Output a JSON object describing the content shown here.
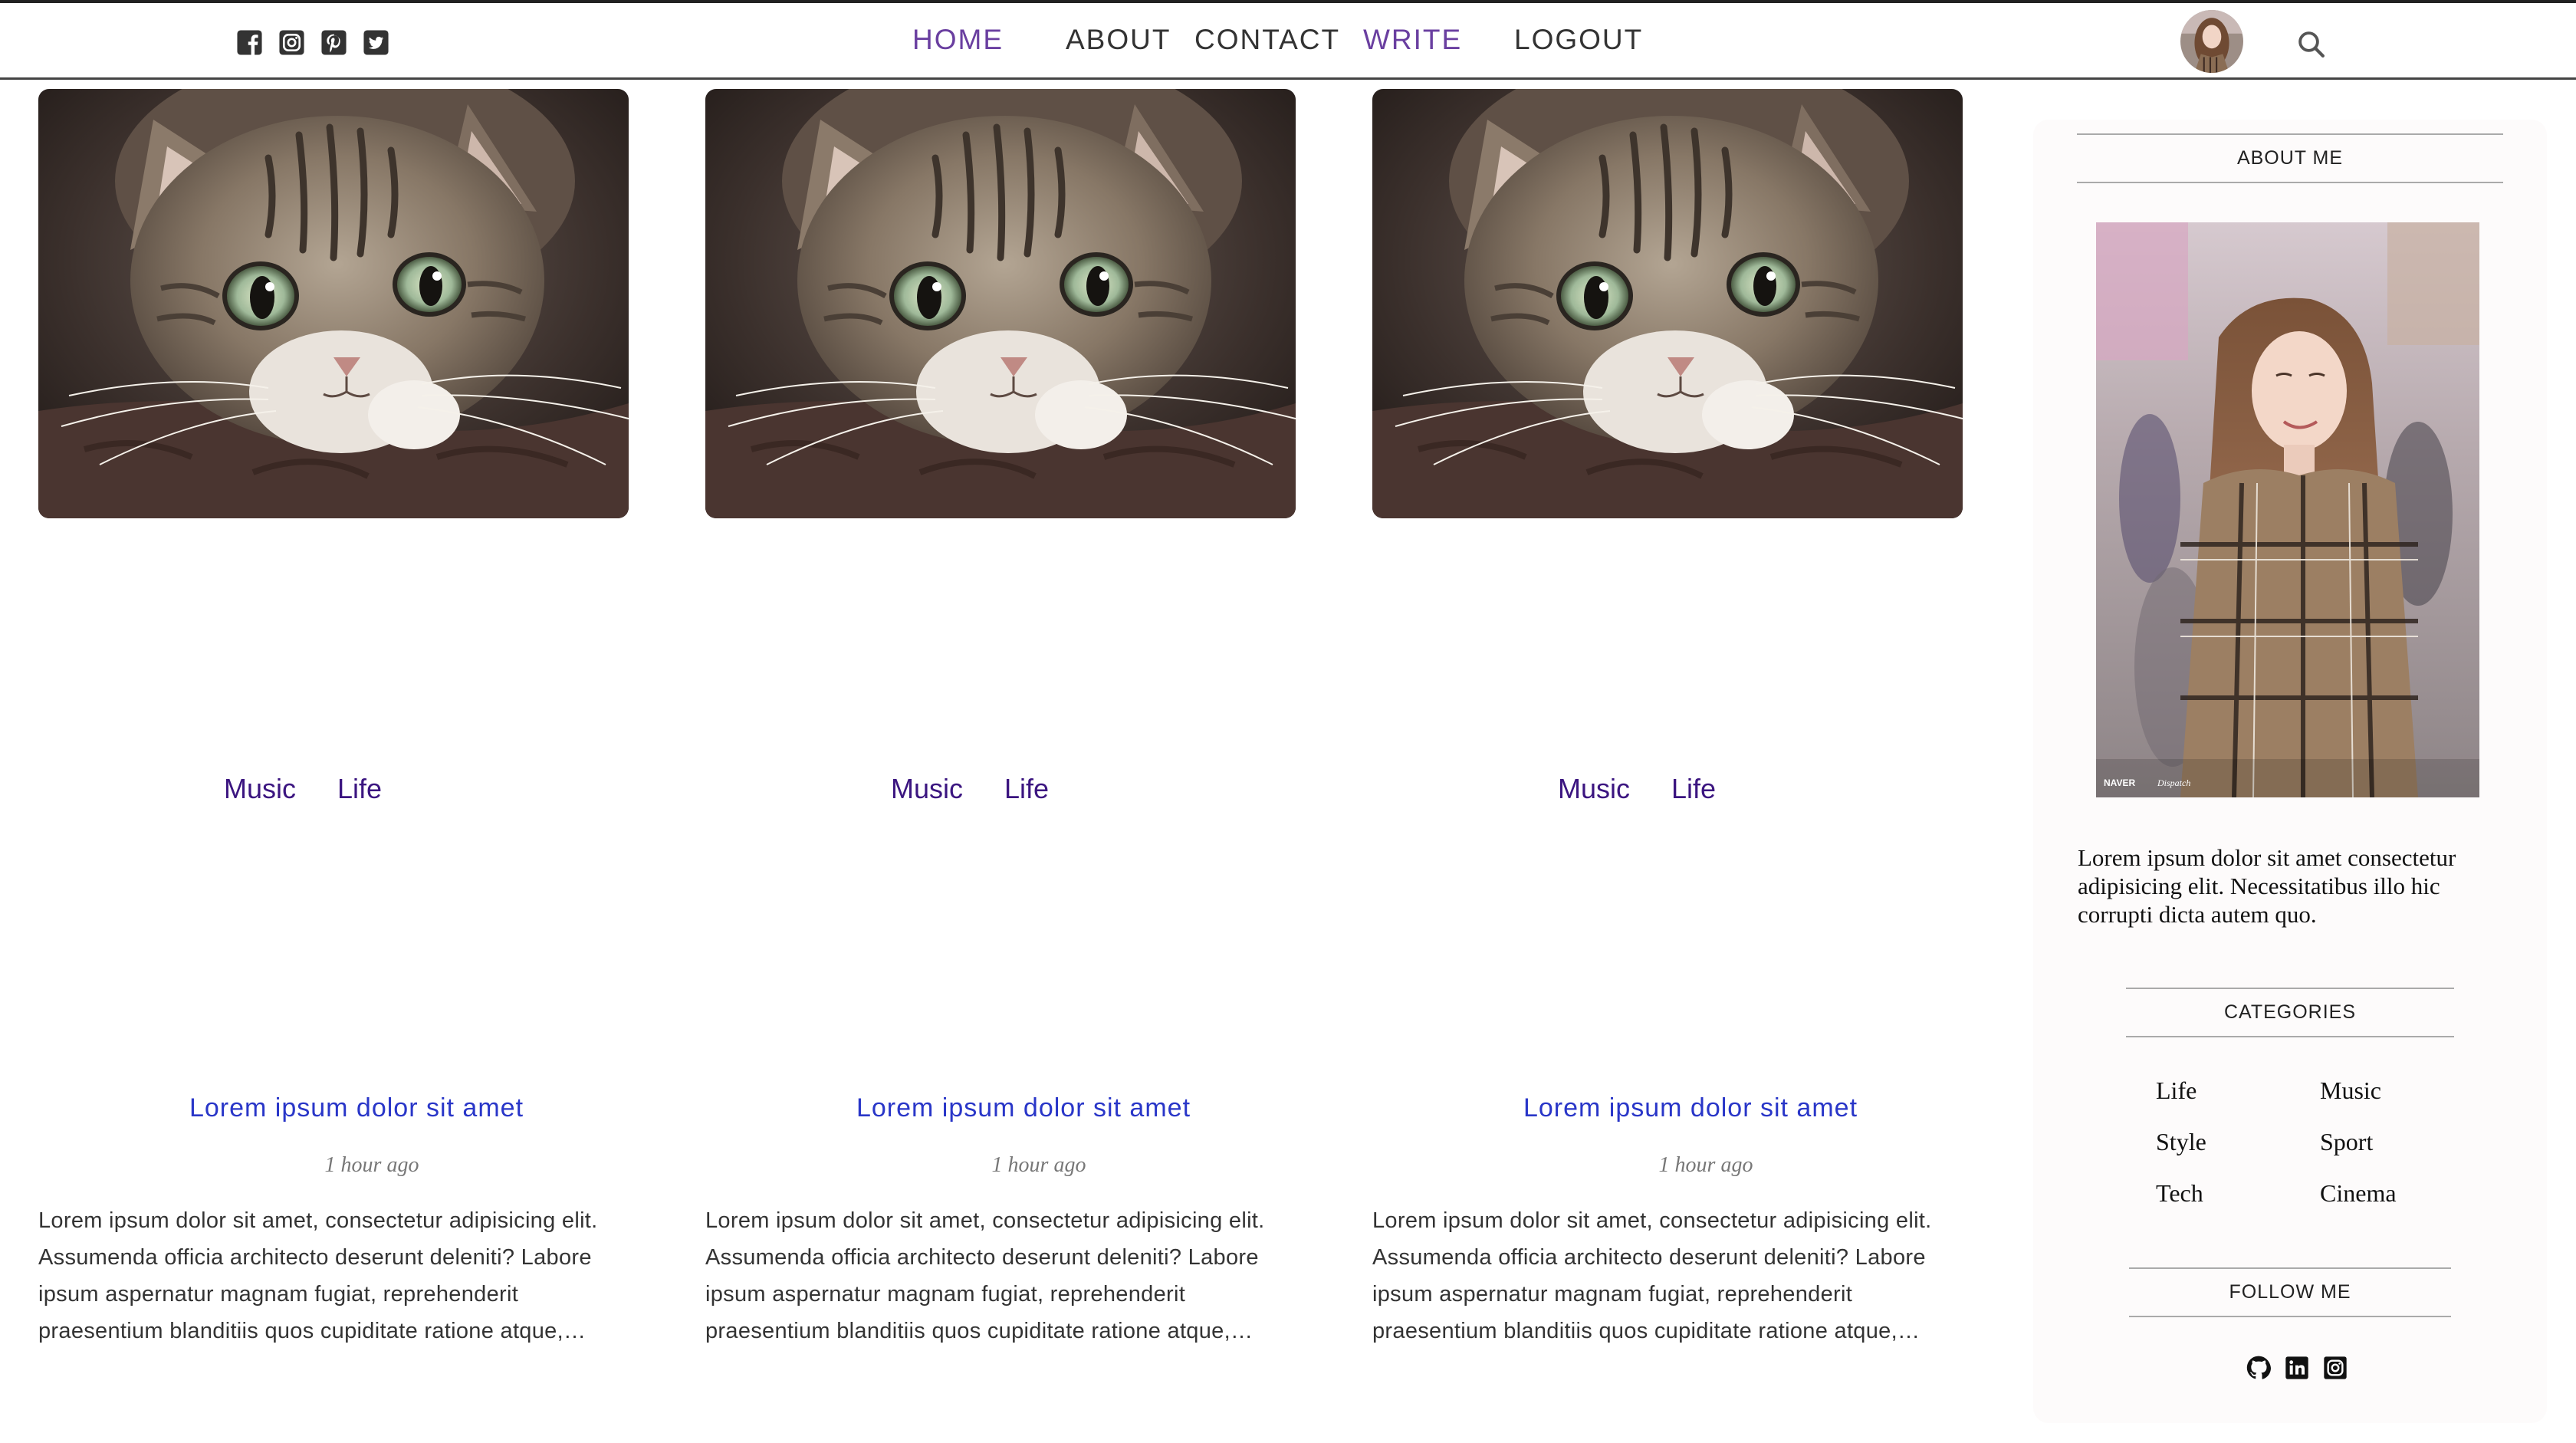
{
  "header": {
    "nav": {
      "home": "HOME",
      "about": "ABOUT",
      "contact": "CONTACT",
      "write": "WRITE",
      "logout": "LOGOUT"
    },
    "social_icons": [
      "facebook-square-icon",
      "instagram-square-icon",
      "pinterest-square-icon",
      "twitter-square-icon"
    ],
    "accent_color": "#6a3fa0"
  },
  "posts": [
    {
      "categories": [
        "Music",
        "Life"
      ],
      "title": "Lorem ipsum dolor sit amet",
      "date": "1 hour ago",
      "description": "Lorem ipsum dolor sit amet, consectetur adipisicing elit. Assumenda officia architecto deserunt deleniti? Labore ipsum aspernatur magnam fugiat, reprehenderit praesentium blanditiis quos cupiditate ratione atque, mollitia sit ipsum dolor amet."
    },
    {
      "categories": [
        "Music",
        "Life"
      ],
      "title": "Lorem ipsum dolor sit amet",
      "date": "1 hour ago",
      "description": "Lorem ipsum dolor sit amet, consectetur adipisicing elit. Assumenda officia architecto deserunt deleniti? Labore ipsum aspernatur magnam fugiat, reprehenderit praesentium blanditiis quos cupiditate ratione atque, mollitia sit ipsum dolor amet."
    },
    {
      "categories": [
        "Music",
        "Life"
      ],
      "title": "Lorem ipsum dolor sit amet",
      "date": "1 hour ago",
      "description": "Lorem ipsum dolor sit amet, consectetur adipisicing elit. Assumenda officia architecto deserunt deleniti? Labore ipsum aspernatur magnam fugiat, reprehenderit praesentium blanditiis quos cupiditate ratione atque, mollitia sit ipsum dolor amet."
    }
  ],
  "sidebar": {
    "about_heading": "ABOUT ME",
    "about_text": "Lorem ipsum dolor sit amet consectetur adipisicing elit. Necessitatibus illo hic corrupti dicta autem quo.",
    "photo_watermark_left": "NAVER",
    "photo_watermark_right": "Dispatch",
    "categories_heading": "CATEGORIES",
    "categories": [
      "Life",
      "Music",
      "Style",
      "Sport",
      "Tech",
      "Cinema"
    ],
    "follow_heading": "FOLLOW ME",
    "follow_icons": [
      "github-icon",
      "linkedin-icon",
      "instagram-icon"
    ]
  }
}
